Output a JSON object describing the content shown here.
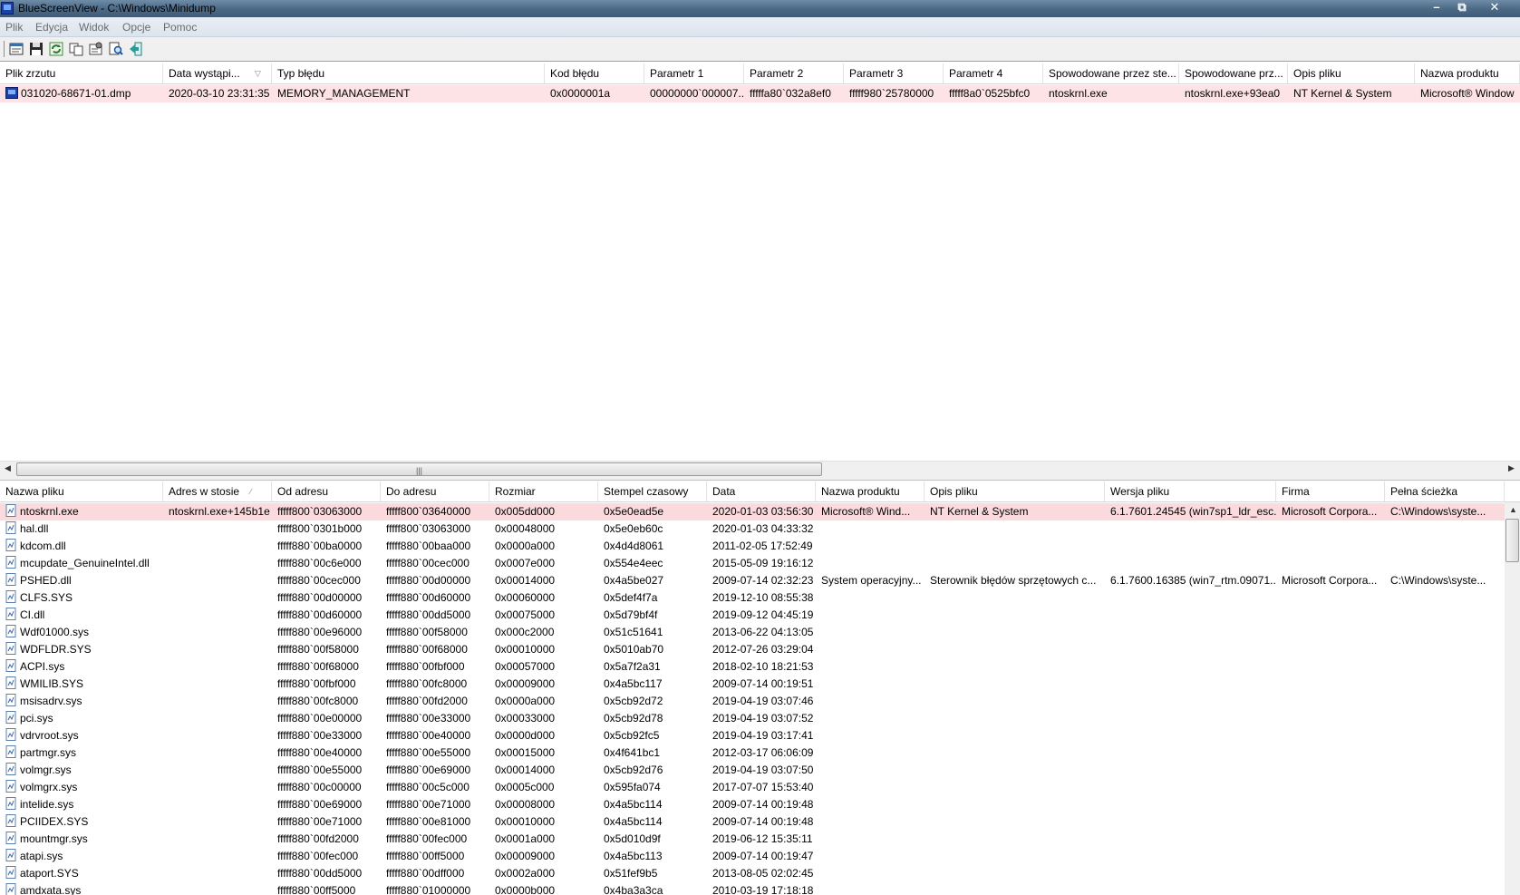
{
  "window": {
    "title": "BlueScreenView  -  C:\\Windows\\Minidump",
    "minimize": "–",
    "maximize": "⧉",
    "close": "✕"
  },
  "menu": [
    "Plik",
    "Edycja",
    "Widok",
    "Opcje",
    "Pomoc"
  ],
  "toolbar": [
    "properties-icon",
    "save-icon",
    "refresh-icon",
    "copy-icon",
    "options-icon",
    "find-icon",
    "exit-icon"
  ],
  "upper": {
    "columns": [
      "Plik zrzutu",
      "Data wystąpi...",
      "Typ błędu",
      "Kod błędu",
      "Parametr 1",
      "Parametr 2",
      "Parametr 3",
      "Parametr 4",
      "Spowodowane przez ste...",
      "Spowodowane prz...",
      "Opis pliku",
      "Nazwa produktu"
    ],
    "rows": [
      [
        "031020-68671-01.dmp",
        "2020-03-10 23:31:35",
        "MEMORY_MANAGEMENT",
        "0x0000001a",
        "00000000`000007...",
        "fffffa80`032a8ef0",
        "fffff980`25780000",
        "fffff8a0`0525bfc0",
        "ntoskrnl.exe",
        "ntoskrnl.exe+93ea0",
        "NT Kernel & System",
        "Microsoft® Window"
      ]
    ]
  },
  "lower": {
    "columns": [
      "Nazwa pliku",
      "Adres w stosie",
      "Od adresu",
      "Do adresu",
      "Rozmiar",
      "Stempel czasowy",
      "Data",
      "Nazwa produktu",
      "Opis pliku",
      "Wersja pliku",
      "Firma",
      "Pełna ścieżka"
    ],
    "rows": [
      [
        "ntoskrnl.exe",
        "ntoskrnl.exe+145b1e",
        "fffff800`03063000",
        "fffff800`03640000",
        "0x005dd000",
        "0x5e0ead5e",
        "2020-01-03 03:56:30",
        "Microsoft® Wind...",
        "NT Kernel & System",
        "6.1.7601.24545 (win7sp1_ldr_esc...",
        "Microsoft Corpora...",
        "C:\\Windows\\syste..."
      ],
      [
        "hal.dll",
        "",
        "fffff800`0301b000",
        "fffff800`03063000",
        "0x00048000",
        "0x5e0eb60c",
        "2020-01-03 04:33:32",
        "",
        "",
        "",
        "",
        ""
      ],
      [
        "kdcom.dll",
        "",
        "fffff880`00ba0000",
        "fffff880`00baa000",
        "0x0000a000",
        "0x4d4d8061",
        "2011-02-05 17:52:49",
        "",
        "",
        "",
        "",
        ""
      ],
      [
        "mcupdate_GenuineIntel.dll",
        "",
        "fffff880`00c6e000",
        "fffff880`00cec000",
        "0x0007e000",
        "0x554e4eec",
        "2015-05-09 19:16:12",
        "",
        "",
        "",
        "",
        ""
      ],
      [
        "PSHED.dll",
        "",
        "fffff880`00cec000",
        "fffff880`00d00000",
        "0x00014000",
        "0x4a5be027",
        "2009-07-14 02:32:23",
        "System operacyjny...",
        "Sterownik błędów sprzętowych c...",
        "6.1.7600.16385 (win7_rtm.09071...",
        "Microsoft Corpora...",
        "C:\\Windows\\syste..."
      ],
      [
        "CLFS.SYS",
        "",
        "fffff880`00d00000",
        "fffff880`00d60000",
        "0x00060000",
        "0x5def4f7a",
        "2019-12-10 08:55:38",
        "",
        "",
        "",
        "",
        ""
      ],
      [
        "CI.dll",
        "",
        "fffff880`00d60000",
        "fffff880`00dd5000",
        "0x00075000",
        "0x5d79bf4f",
        "2019-09-12 04:45:19",
        "",
        "",
        "",
        "",
        ""
      ],
      [
        "Wdf01000.sys",
        "",
        "fffff880`00e96000",
        "fffff880`00f58000",
        "0x000c2000",
        "0x51c51641",
        "2013-06-22 04:13:05",
        "",
        "",
        "",
        "",
        ""
      ],
      [
        "WDFLDR.SYS",
        "",
        "fffff880`00f58000",
        "fffff880`00f68000",
        "0x00010000",
        "0x5010ab70",
        "2012-07-26 03:29:04",
        "",
        "",
        "",
        "",
        ""
      ],
      [
        "ACPI.sys",
        "",
        "fffff880`00f68000",
        "fffff880`00fbf000",
        "0x00057000",
        "0x5a7f2a31",
        "2018-02-10 18:21:53",
        "",
        "",
        "",
        "",
        ""
      ],
      [
        "WMILIB.SYS",
        "",
        "fffff880`00fbf000",
        "fffff880`00fc8000",
        "0x00009000",
        "0x4a5bc117",
        "2009-07-14 00:19:51",
        "",
        "",
        "",
        "",
        ""
      ],
      [
        "msisadrv.sys",
        "",
        "fffff880`00fc8000",
        "fffff880`00fd2000",
        "0x0000a000",
        "0x5cb92d72",
        "2019-04-19 03:07:46",
        "",
        "",
        "",
        "",
        ""
      ],
      [
        "pci.sys",
        "",
        "fffff880`00e00000",
        "fffff880`00e33000",
        "0x00033000",
        "0x5cb92d78",
        "2019-04-19 03:07:52",
        "",
        "",
        "",
        "",
        ""
      ],
      [
        "vdrvroot.sys",
        "",
        "fffff880`00e33000",
        "fffff880`00e40000",
        "0x0000d000",
        "0x5cb92fc5",
        "2019-04-19 03:17:41",
        "",
        "",
        "",
        "",
        ""
      ],
      [
        "partmgr.sys",
        "",
        "fffff880`00e40000",
        "fffff880`00e55000",
        "0x00015000",
        "0x4f641bc1",
        "2012-03-17 06:06:09",
        "",
        "",
        "",
        "",
        ""
      ],
      [
        "volmgr.sys",
        "",
        "fffff880`00e55000",
        "fffff880`00e69000",
        "0x00014000",
        "0x5cb92d76",
        "2019-04-19 03:07:50",
        "",
        "",
        "",
        "",
        ""
      ],
      [
        "volmgrx.sys",
        "",
        "fffff880`00c00000",
        "fffff880`00c5c000",
        "0x0005c000",
        "0x595fa074",
        "2017-07-07 15:53:40",
        "",
        "",
        "",
        "",
        ""
      ],
      [
        "intelide.sys",
        "",
        "fffff880`00e69000",
        "fffff880`00e71000",
        "0x00008000",
        "0x4a5bc114",
        "2009-07-14 00:19:48",
        "",
        "",
        "",
        "",
        ""
      ],
      [
        "PCIIDEX.SYS",
        "",
        "fffff880`00e71000",
        "fffff880`00e81000",
        "0x00010000",
        "0x4a5bc114",
        "2009-07-14 00:19:48",
        "",
        "",
        "",
        "",
        ""
      ],
      [
        "mountmgr.sys",
        "",
        "fffff880`00fd2000",
        "fffff880`00fec000",
        "0x0001a000",
        "0x5d010d9f",
        "2019-06-12 15:35:11",
        "",
        "",
        "",
        "",
        ""
      ],
      [
        "atapi.sys",
        "",
        "fffff880`00fec000",
        "fffff880`00ff5000",
        "0x00009000",
        "0x4a5bc113",
        "2009-07-14 00:19:47",
        "",
        "",
        "",
        "",
        ""
      ],
      [
        "ataport.SYS",
        "",
        "fffff880`00dd5000",
        "fffff880`00dff000",
        "0x0002a000",
        "0x51fef9b5",
        "2013-08-05 02:02:45",
        "",
        "",
        "",
        "",
        ""
      ],
      [
        "amdxata.sys",
        "",
        "fffff880`00ff5000",
        "fffff880`01000000",
        "0x0000b000",
        "0x4ba3a3ca",
        "2010-03-19 17:18:18",
        "",
        "",
        "",
        "",
        ""
      ]
    ]
  },
  "colors": {
    "selected_row": "#fadadd"
  }
}
